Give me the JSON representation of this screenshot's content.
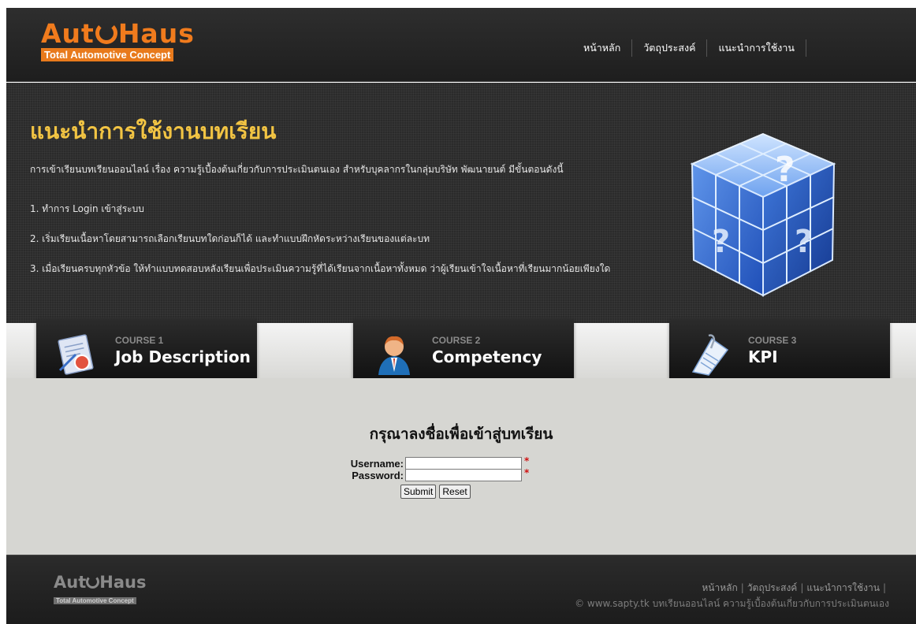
{
  "brand": {
    "name_part1": "Aut",
    "name_part2": "Haus",
    "tagline": "Total Automotive Concept"
  },
  "nav": {
    "items": [
      {
        "label": "หน้าหลัก"
      },
      {
        "label": "วัตถุประสงค์"
      },
      {
        "label": "แนะนำการใช้งาน"
      }
    ]
  },
  "hero": {
    "title": "แนะนำการใช้งานบทเรียน",
    "intro": "การเข้าเรียนบทเรียนออนไลน์ เรื่อง ความรู้เบื้องต้นเกี่ยวกับการประเมินตนเอง สำหรับบุคลากรในกลุ่มบริษัท พัฒนายนต์ มีขั้นตอนดังนี้",
    "steps": [
      "1. ทำการ Login เข้าสู่ระบบ",
      "2. เริ่มเรียนเนื้อหาโดยสามารถเลือกเรียนบทใดก่อนก็ได้ และทำแบบฝึกหัดระหว่างเรียนของแต่ละบท",
      "3. เมื่อเรียนครบทุกหัวข้อ ให้ทำแบบทดสอบหลังเรียนเพื่อประเมินความรู้ที่ได้เรียนจากเนื้อหาทั้งหมด ว่าผู้เรียนเข้าใจเนื้อหาที่เรียนมากน้อยเพียงใด"
    ],
    "image_icon": "question-cube-icon"
  },
  "courses": [
    {
      "number": "COURSE 1",
      "name": "Job Description",
      "icon": "document-stamp-icon"
    },
    {
      "number": "COURSE 2",
      "name": "Competency",
      "icon": "business-person-icon"
    },
    {
      "number": "COURSE 3",
      "name": "KPI",
      "icon": "document-clip-icon"
    }
  ],
  "login": {
    "title": "กรุณาลงชื่อเพื่อเข้าสู่บทเรียน",
    "username_label": "Username:",
    "password_label": "Password:",
    "username_value": "",
    "password_value": "",
    "required_mark": "*",
    "submit_label": "Submit",
    "reset_label": "Reset"
  },
  "footer": {
    "links": [
      {
        "label": "หน้าหลัก"
      },
      {
        "label": "วัตถุประสงค์"
      },
      {
        "label": "แนะนำการใช้งาน"
      }
    ],
    "separator": "|",
    "copyright": "© www.sapty.tk บทเรียนออนไลน์ ความรู้เบื้องต้นเกี่ยวกับการประเมินตนเอง"
  },
  "colors": {
    "brand_orange": "#f07b1d",
    "hero_title": "#f2c443",
    "header_bg": "#2a2a2a",
    "content_bg": "#d6d6d2",
    "required": "#d01010"
  }
}
